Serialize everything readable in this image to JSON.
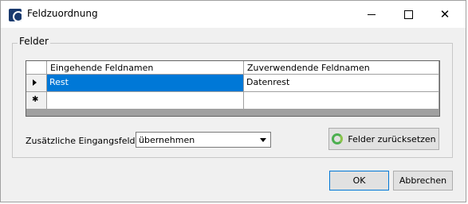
{
  "window": {
    "title": "Feldzuordnung",
    "icon": "app-icon"
  },
  "group": {
    "label": "Felder"
  },
  "grid": {
    "columns": [
      "Eingehende Feldnamen",
      "Zuverwendende Feldnamen"
    ],
    "rows": [
      {
        "incoming": "Rest",
        "target": "Datenrest",
        "selected": true
      },
      {
        "incoming": "",
        "target": "",
        "new_row": true
      }
    ]
  },
  "extra_fields": {
    "label": "Zusätzliche Eingangsfelder",
    "value": "übernehmen"
  },
  "buttons": {
    "reset": "Felder zurücksetzen",
    "ok": "OK",
    "cancel": "Abbrechen"
  },
  "colors": {
    "selection": "#0078d7",
    "accent": "#0078d7"
  }
}
